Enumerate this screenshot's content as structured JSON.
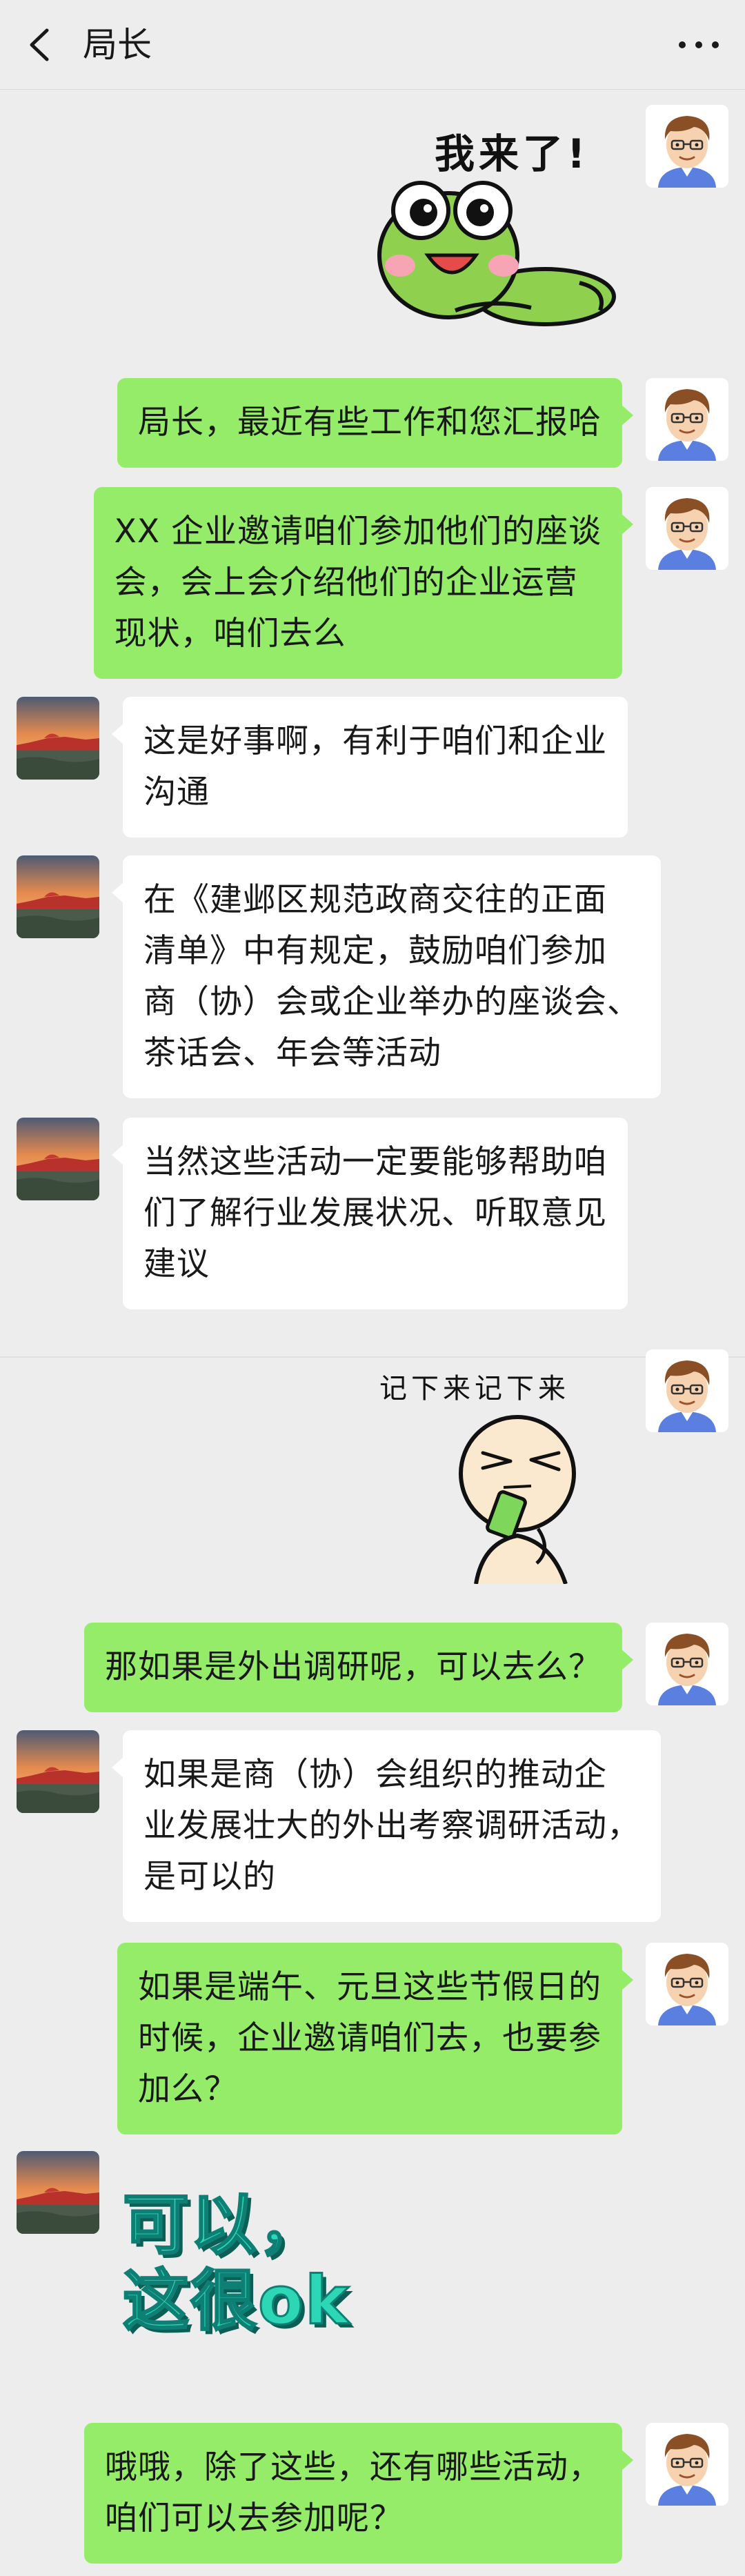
{
  "header": {
    "title": "局长"
  },
  "stickers": {
    "frog_caption": "我来了!",
    "notes_caption": "记下来记下来",
    "ok_line1": "可以，",
    "ok_line2": "这很ok"
  },
  "messages": [
    {
      "from": "me",
      "text": "局长，最近有些工作和您汇报哈"
    },
    {
      "from": "me",
      "text": "XX 企业邀请咱们参加他们的座谈\n会，会上会介绍他们的企业运营\n现状，咱们去么"
    },
    {
      "from": "them",
      "text": "这是好事啊，有利于咱们和企业\n沟通"
    },
    {
      "from": "them",
      "text": "在《建邺区规范政商交往的正面\n清单》中有规定，鼓励咱们参加\n商（协）会或企业举办的座谈会、\n茶话会、年会等活动"
    },
    {
      "from": "them",
      "text": "当然这些活动一定要能够帮助咱\n们了解行业发展状况、听取意见\n建议"
    },
    {
      "from": "me",
      "text": "那如果是外出调研呢，可以去么？"
    },
    {
      "from": "them",
      "text": "如果是商（协）会组织的推动企\n业发展壮大的外出考察调研活动，\n是可以的"
    },
    {
      "from": "me",
      "text": "如果是端午、元旦这些节假日的\n时候，企业邀请咱们去，也要参\n加么？"
    },
    {
      "from": "me",
      "text": "哦哦，除了这些，还有哪些活动，\n咱们可以去参加呢？"
    }
  ],
  "colors": {
    "background": "#ededed",
    "my_bubble": "#95ec69",
    "their_bubble": "#ffffff"
  }
}
